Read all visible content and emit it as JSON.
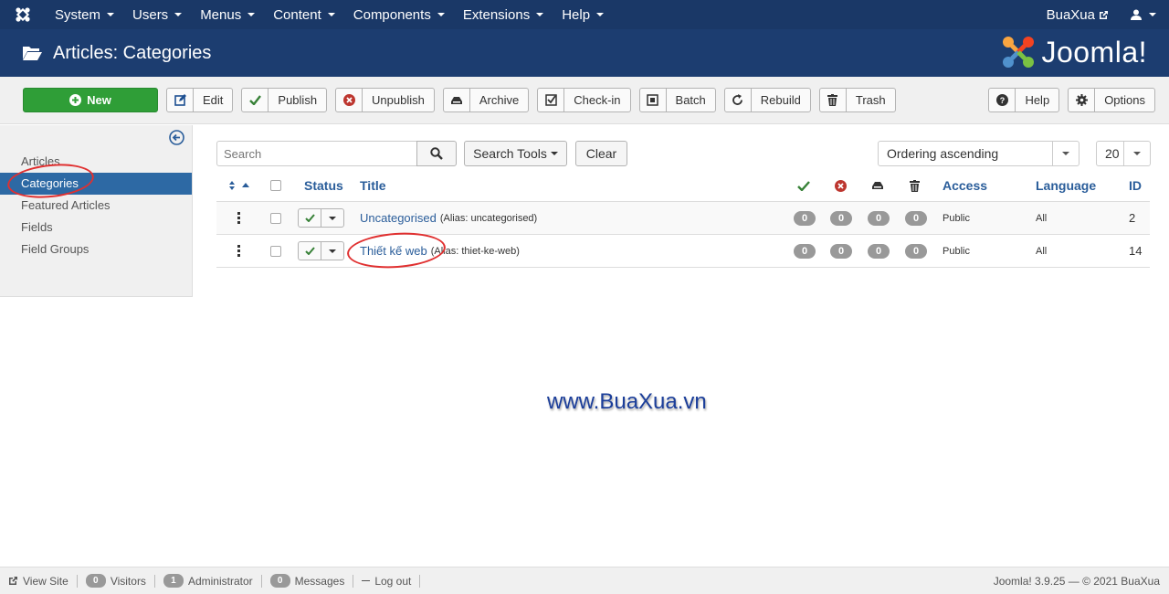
{
  "topbar": {
    "menus": [
      {
        "label": "System"
      },
      {
        "label": "Users"
      },
      {
        "label": "Menus"
      },
      {
        "label": "Content"
      },
      {
        "label": "Components"
      },
      {
        "label": "Extensions"
      },
      {
        "label": "Help"
      }
    ],
    "site_name": "BuaXua"
  },
  "header": {
    "title": "Articles: Categories",
    "brand": "Joomla!"
  },
  "toolbar": {
    "new_label": "New",
    "edit_label": "Edit",
    "publish_label": "Publish",
    "unpublish_label": "Unpublish",
    "archive_label": "Archive",
    "checkin_label": "Check-in",
    "batch_label": "Batch",
    "rebuild_label": "Rebuild",
    "trash_label": "Trash",
    "help_label": "Help",
    "options_label": "Options"
  },
  "sidebar": {
    "items": [
      {
        "label": "Articles"
      },
      {
        "label": "Categories"
      },
      {
        "label": "Featured Articles"
      },
      {
        "label": "Fields"
      },
      {
        "label": "Field Groups"
      }
    ]
  },
  "filter": {
    "search_placeholder": "Search",
    "search_tools_label": "Search Tools",
    "clear_label": "Clear",
    "ordering": "Ordering ascending",
    "limit": "20"
  },
  "table": {
    "headers": {
      "status": "Status",
      "title": "Title",
      "access": "Access",
      "language": "Language",
      "id": "ID"
    },
    "rows": [
      {
        "title": "Uncategorised",
        "alias": "(Alias: uncategorised)",
        "published": "0",
        "unpublished": "0",
        "archived": "0",
        "trashed": "0",
        "access": "Public",
        "language": "All",
        "id": "2"
      },
      {
        "title": "Thiết kế web",
        "alias": "(Alias: thiet-ke-web)",
        "published": "0",
        "unpublished": "0",
        "archived": "0",
        "trashed": "0",
        "access": "Public",
        "language": "All",
        "id": "14"
      }
    ]
  },
  "watermark": "www.BuaXua.vn",
  "footer": {
    "view_site": "View Site",
    "visitors_count": "0",
    "visitors_label": "Visitors",
    "admin_count": "1",
    "admin_label": "Administrator",
    "messages_count": "0",
    "messages_label": "Messages",
    "logout_label": "Log out",
    "copyright": "Joomla! 3.9.25 — © 2021 BuaXua"
  },
  "colors": {
    "topbar": "#1a3867",
    "header": "#1c3d70",
    "new_button": "#2f9e37",
    "active_sidebar": "#2d69a4",
    "link": "#2a5d9a",
    "annotation": "#e03030"
  }
}
